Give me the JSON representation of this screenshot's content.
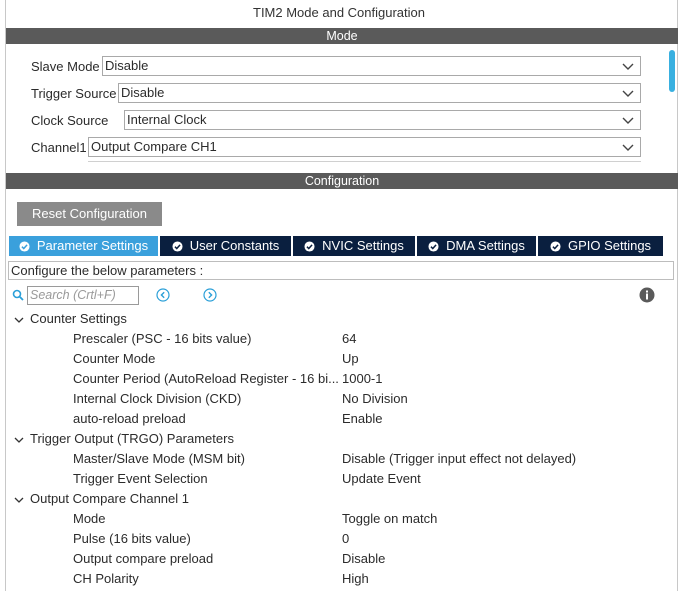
{
  "window": {
    "title": "TIM2 Mode and Configuration"
  },
  "mode_section": {
    "header": "Mode",
    "fields": [
      {
        "label": "Slave Mode",
        "value": "Disable"
      },
      {
        "label": "Trigger Source",
        "value": "Disable"
      },
      {
        "label": "Clock Source",
        "value": "Internal Clock"
      },
      {
        "label": "Channel1",
        "value": "Output Compare CH1"
      }
    ]
  },
  "config_section": {
    "header": "Configuration",
    "reset_button": "Reset Configuration",
    "tabs": [
      {
        "label": "Parameter Settings",
        "active": true
      },
      {
        "label": "User Constants",
        "active": false
      },
      {
        "label": "NVIC Settings",
        "active": false
      },
      {
        "label": "DMA Settings",
        "active": false
      },
      {
        "label": "GPIO Settings",
        "active": false
      }
    ],
    "configure_text": "Configure the below parameters :",
    "search_placeholder": "Search (Crtl+F)",
    "groups": [
      {
        "name": "Counter Settings",
        "params": [
          {
            "name": "Prescaler (PSC - 16 bits value)",
            "value": "64"
          },
          {
            "name": "Counter Mode",
            "value": "Up"
          },
          {
            "name": "Counter Period (AutoReload Register - 16 bi...",
            "value": "1000-1"
          },
          {
            "name": "Internal Clock Division (CKD)",
            "value": "No Division"
          },
          {
            "name": "auto-reload preload",
            "value": "Enable"
          }
        ]
      },
      {
        "name": "Trigger Output (TRGO) Parameters",
        "params": [
          {
            "name": "Master/Slave Mode (MSM bit)",
            "value": "Disable (Trigger input effect not delayed)"
          },
          {
            "name": "Trigger Event Selection",
            "value": "Update Event"
          }
        ]
      },
      {
        "name": "Output Compare Channel 1",
        "params": [
          {
            "name": "Mode",
            "value": "Toggle on match"
          },
          {
            "name": "Pulse (16 bits value)",
            "value": "0"
          },
          {
            "name": "Output compare preload",
            "value": "Disable"
          },
          {
            "name": "CH Polarity",
            "value": "High"
          }
        ]
      }
    ]
  },
  "colors": {
    "header_bar": "#5a5a5a",
    "tab_active": "#3aa0dc",
    "tab_inactive": "#0a1f3f",
    "scrollbar": "#39b0e0",
    "icon_blue": "#2a9fd8"
  },
  "icons": [
    "search-icon",
    "previous-icon",
    "next-icon",
    "info-icon",
    "check-circle-icon",
    "chevron-down-icon",
    "collapse-arrow-icon"
  ]
}
